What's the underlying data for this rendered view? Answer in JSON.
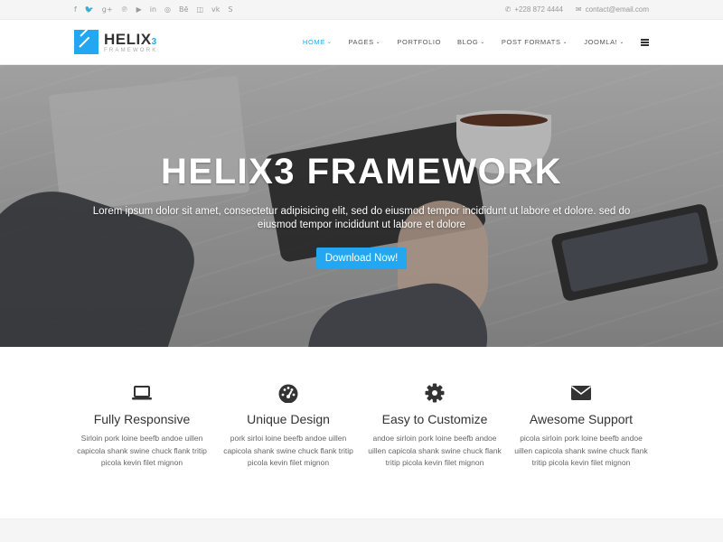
{
  "topbar": {
    "social_icons": [
      {
        "name": "facebook-icon",
        "glyph": "f"
      },
      {
        "name": "twitter-icon",
        "glyph": "🐦"
      },
      {
        "name": "google-plus-icon",
        "glyph": "g+"
      },
      {
        "name": "pinterest-icon",
        "glyph": "℗"
      },
      {
        "name": "youtube-icon",
        "glyph": "▶"
      },
      {
        "name": "linkedin-icon",
        "glyph": "in"
      },
      {
        "name": "dribbble-icon",
        "glyph": "◎"
      },
      {
        "name": "behance-icon",
        "glyph": "Bē"
      },
      {
        "name": "flickr-icon",
        "glyph": "◫"
      },
      {
        "name": "vk-icon",
        "glyph": "vk"
      },
      {
        "name": "skype-icon",
        "glyph": "S"
      }
    ],
    "phone": "+228 872 4444",
    "email": "contact@email.com"
  },
  "header": {
    "logo_title": "HELIX",
    "logo_version": "3",
    "logo_sub": "FRAMEWORK",
    "nav": [
      {
        "label": "HOME",
        "dropdown": true,
        "active": true
      },
      {
        "label": "PAGES",
        "dropdown": true,
        "active": false
      },
      {
        "label": "PORTFOLIO",
        "dropdown": false,
        "active": false
      },
      {
        "label": "BLOG",
        "dropdown": true,
        "active": false
      },
      {
        "label": "POST FORMATS",
        "dropdown": true,
        "active": false
      },
      {
        "label": "JOOMLA!",
        "dropdown": true,
        "active": false
      }
    ]
  },
  "hero": {
    "title": "HELIX3 FRAMEWORK",
    "description": "Lorem ipsum dolor sit amet, consectetur adipisicing elit, sed do eiusmod tempor incididunt ut labore et dolore. sed do eiusmod tempor incididunt ut labore et dolore",
    "button": "Download Now!"
  },
  "features": [
    {
      "icon": "laptop-icon",
      "title": "Fully Responsive",
      "text": "Sirloin pork loine beefb andoe uillen capicola shank swine chuck flank tritip picola kevin filet mignon"
    },
    {
      "icon": "dashboard-icon",
      "title": "Unique Design",
      "text": "pork sirloi loine beefb andoe uillen capicola shank swine chuck flank tritip picola kevin filet mignon"
    },
    {
      "icon": "gear-icon",
      "title": "Easy to Customize",
      "text": "andoe sirloin pork loine beefb andoe uillen capicola shank swine chuck flank tritip picola kevin filet mignon"
    },
    {
      "icon": "envelope-icon",
      "title": "Awesome Support",
      "text": "picola sirloin pork loine beefb andoe uillen capicola shank swine chuck flank tritip picola kevin filet mignon"
    }
  ],
  "colors": {
    "accent": "#22a7f0",
    "text": "#333333",
    "muted": "#999999"
  }
}
